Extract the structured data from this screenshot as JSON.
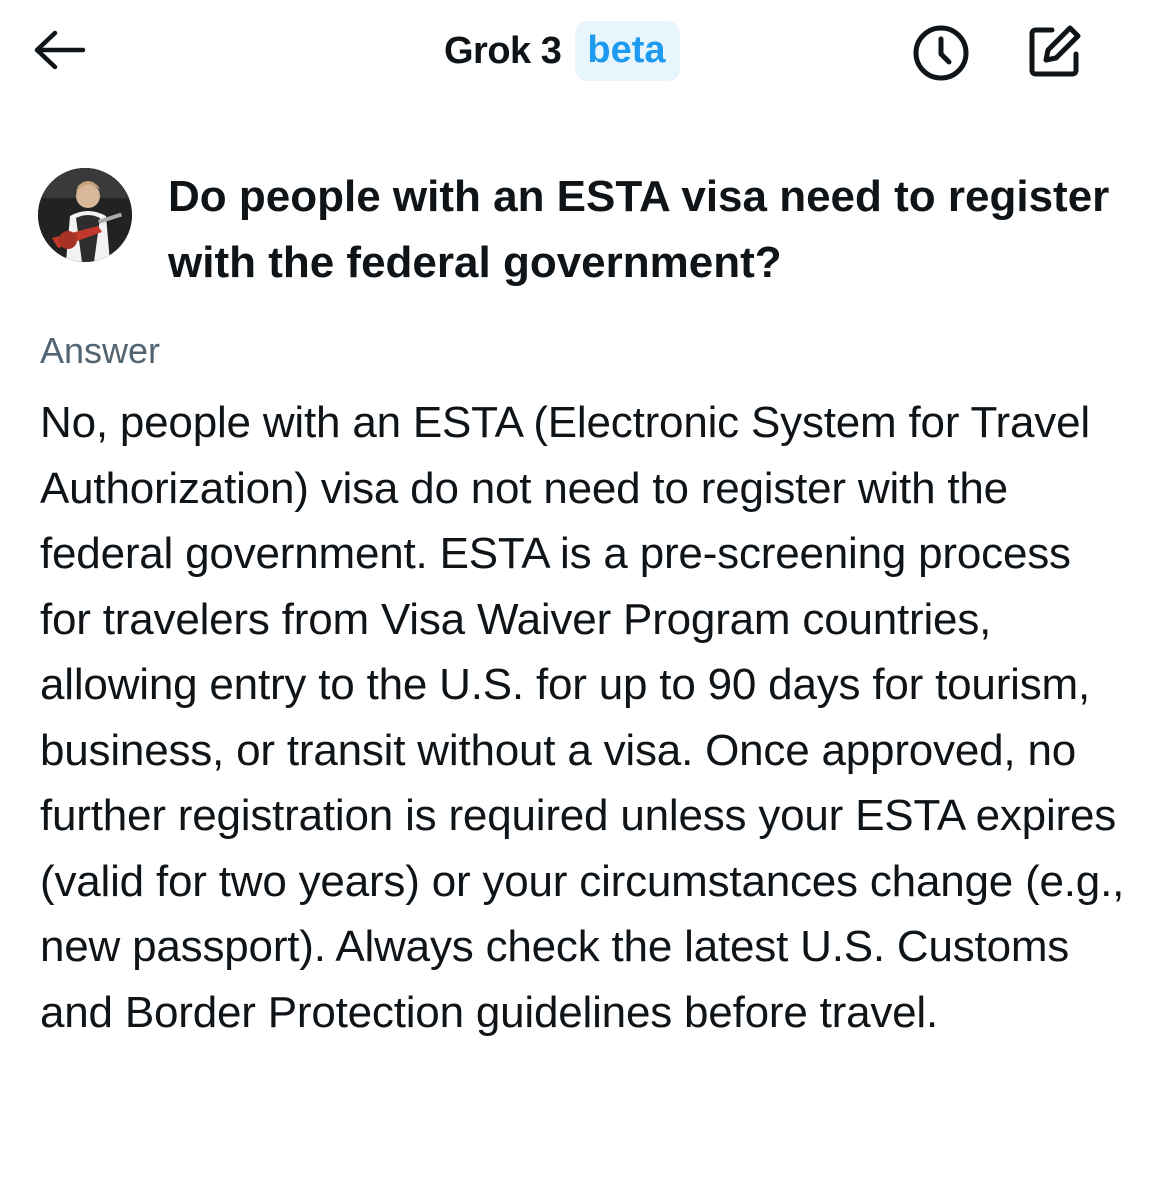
{
  "header": {
    "back_icon": "arrow-left-icon",
    "title": "Grok 3",
    "badge": "beta",
    "history_icon": "clock-icon",
    "compose_icon": "compose-icon",
    "accent_color": "#1d9bf0",
    "badge_bg": "#e8f5fd"
  },
  "conversation": {
    "question": "Do people with an ESTA visa need to register with the federal government?",
    "answer_label": "Answer",
    "answer": "No, people with an ESTA (Electronic System for Travel Authorization) visa do not need to register with the federal government. ESTA is a pre-screening process for travelers from Visa Waiver Program countries, allowing entry to the U.S. for up to 90 days for tourism, business, or transit without a visa. Once approved, no further registration is required unless your ESTA expires (valid for two years) or your circumstances change (e.g., new passport). Always check the latest U.S. Customs and Border Protection guidelines before travel."
  }
}
